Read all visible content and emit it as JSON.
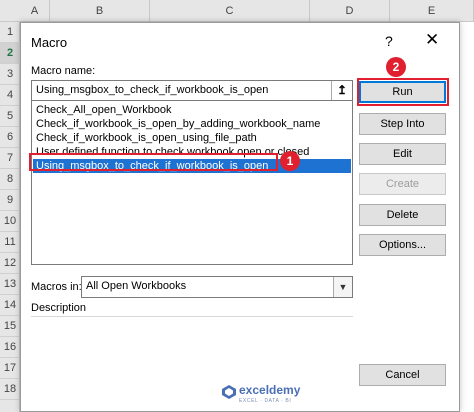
{
  "sheet": {
    "columns": [
      "A",
      "B",
      "C",
      "D",
      "E"
    ],
    "rows": [
      "1",
      "2",
      "3",
      "4",
      "5",
      "6",
      "7",
      "8",
      "9",
      "10",
      "11",
      "12",
      "13",
      "14",
      "15",
      "16",
      "17",
      "18"
    ]
  },
  "dialog": {
    "title": "Macro",
    "help_label": "?",
    "close_label": "✕",
    "macro_name_label": "Macro name:",
    "macro_name_value": "Using_msgbox_to_check_if_workbook_is_open",
    "ref_icon": "↥",
    "macro_list": [
      "Check_All_open_Workbook",
      "Check_if_workbook_is_open_by_adding_workbook_name",
      "Check_if_workbook_is_open_using_file_path",
      "User defined function to check workbook open or closed",
      "Using_msgbox_to_check_if_workbook_is_open"
    ],
    "selected_index": 4,
    "macros_in_label": "Macros in:",
    "macros_in_value": "All Open Workbooks",
    "dropdown_arrow": "▼",
    "description_label": "Description",
    "buttons": {
      "run": "Run",
      "step_into": "Step Into",
      "edit": "Edit",
      "create": "Create",
      "delete": "Delete",
      "options": "Options...",
      "cancel": "Cancel"
    }
  },
  "annotations": {
    "marker_1": "1",
    "marker_2": "2",
    "color": "#e0202e"
  },
  "watermark": {
    "name": "exceldemy",
    "tagline": "EXCEL · DATA · BI"
  },
  "colors": {
    "selection": "#1e73d2",
    "default_button_border": "#0078d7"
  }
}
